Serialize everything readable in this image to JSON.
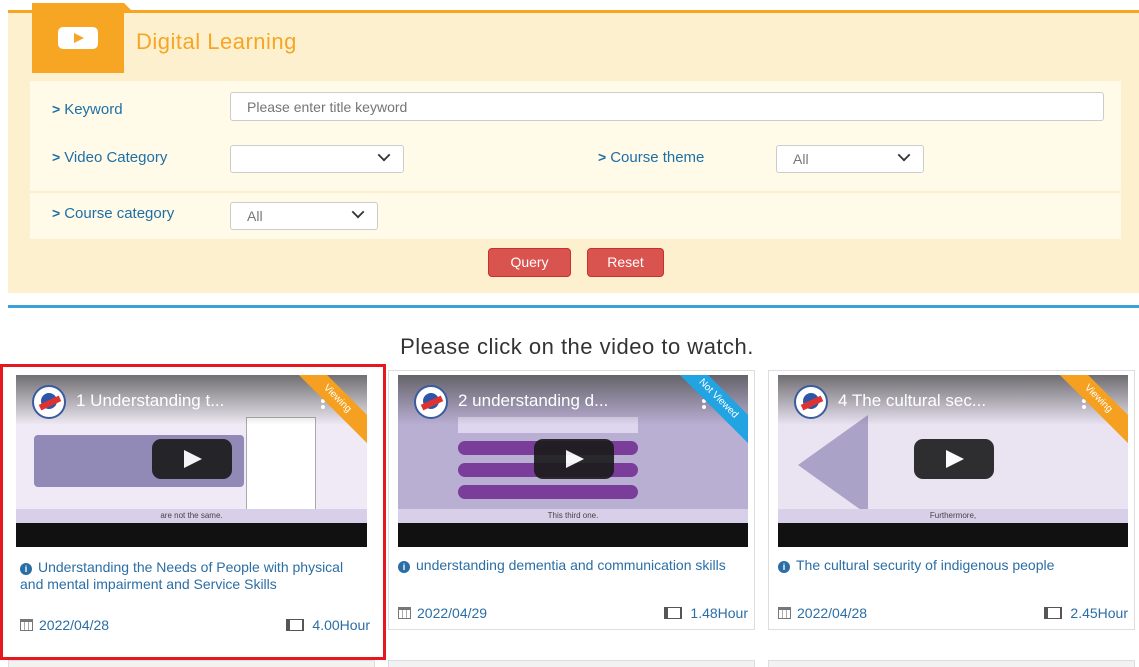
{
  "panel": {
    "title": "Digital Learning",
    "icon": "youtube-play-icon",
    "accent": "#f6a623",
    "keyword": {
      "label": "Keyword",
      "placeholder": "Please enter title keyword",
      "value": ""
    },
    "video_category": {
      "label": "Video Category",
      "value": ""
    },
    "course_theme": {
      "label": "Course theme",
      "value": "All"
    },
    "course_category": {
      "label": "Course category",
      "value": "All"
    },
    "query_label": "Query",
    "reset_label": "Reset"
  },
  "hint": "Please click on the video to watch.",
  "cards": [
    {
      "video_title": "1 Understanding t...",
      "status": "Viewing",
      "slide_caption": "are not the same.",
      "description": "Understanding the Needs of People with physical and mental impairment and Service Skills",
      "date": "2022/04/28",
      "duration": "4.00Hour",
      "selected": true
    },
    {
      "video_title": "2 understanding d...",
      "status": "Not Viewed",
      "slide_caption": "This third one.",
      "description": "understanding dementia and communication skills",
      "date": "2022/04/29",
      "duration": "1.48Hour",
      "selected": false
    },
    {
      "video_title": "4 The cultural sec...",
      "status": "Viewing",
      "slide_caption": "Furthermore,",
      "description": "The cultural security of indigenous people",
      "date": "2022/04/28",
      "duration": "2.45Hour",
      "selected": false
    }
  ]
}
